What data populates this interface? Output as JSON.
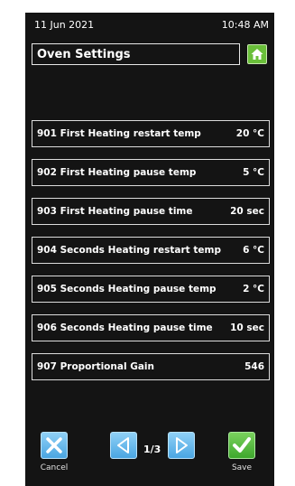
{
  "status": {
    "date": "11 Jun 2021",
    "time": "10:48 AM"
  },
  "header": {
    "title": "Oven Settings"
  },
  "settings": [
    {
      "label": "901 First Heating restart temp",
      "value": "20 °C"
    },
    {
      "label": "902 First Heating pause temp",
      "value": "5 °C"
    },
    {
      "label": "903 First Heating pause time",
      "value": "20 sec"
    },
    {
      "label": "904 Seconds Heating restart  temp",
      "value": "6 °C"
    },
    {
      "label": "905 Seconds Heating pause  temp",
      "value": "2 °C"
    },
    {
      "label": "906 Seconds Heating pause  time",
      "value": "10 sec"
    },
    {
      "label": "907 Proportional Gain",
      "value": "546"
    }
  ],
  "footer": {
    "cancel_label": "Cancel",
    "save_label": "Save",
    "page_indicator": "1/3"
  },
  "icons": {
    "home": "home-icon",
    "cancel": "x-icon",
    "prev": "triangle-left-icon",
    "next": "triangle-right-icon",
    "save": "checkmark-icon"
  },
  "colors": {
    "background": "#141414",
    "accent_green": "#6abf3a",
    "accent_blue": "#5ab0e8"
  }
}
